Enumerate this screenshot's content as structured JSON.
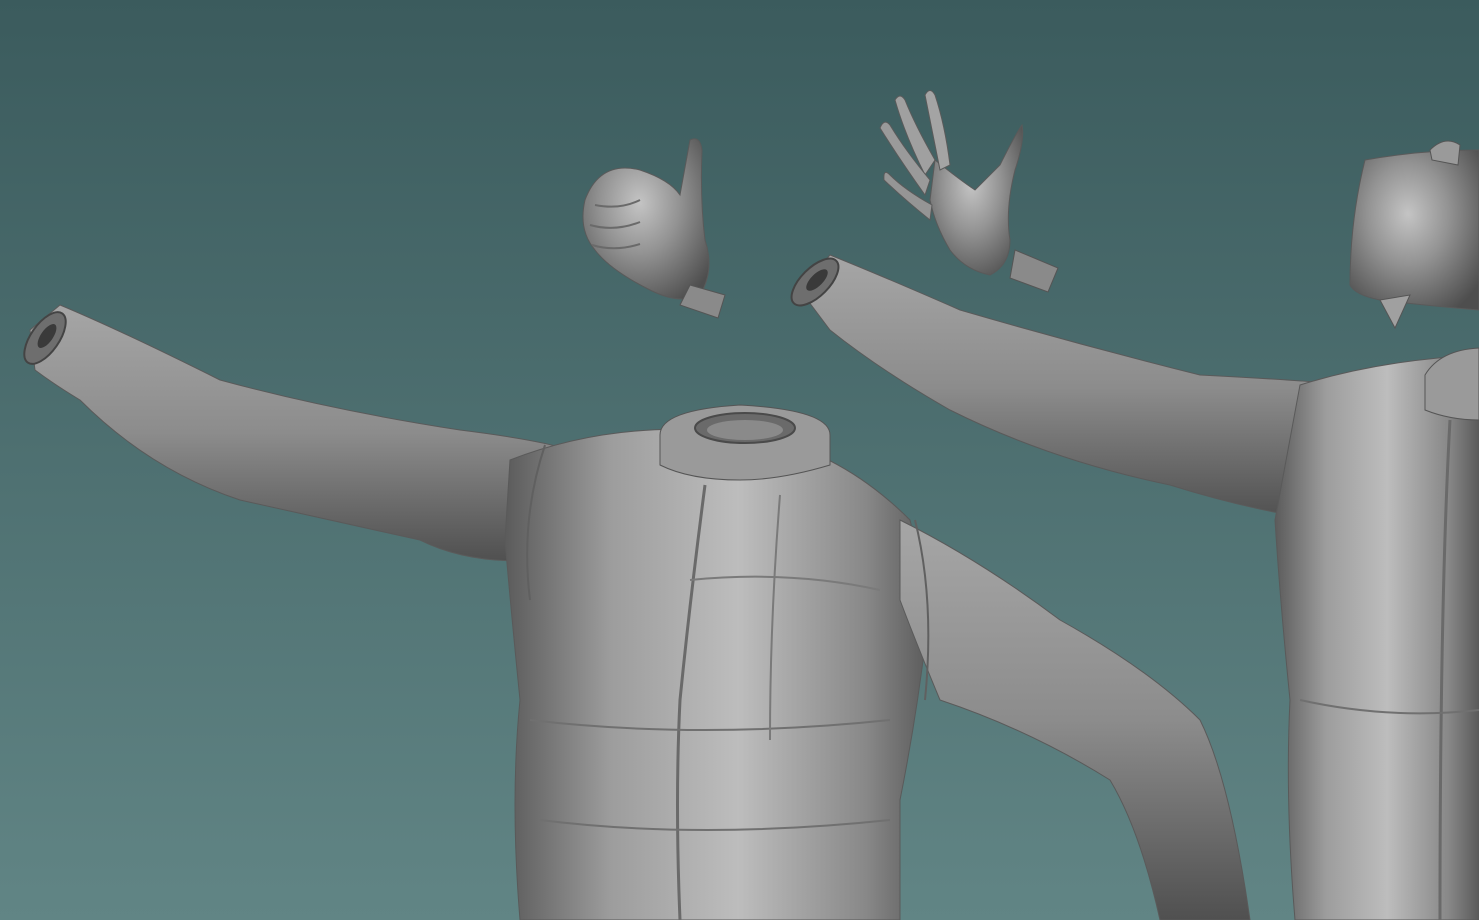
{
  "viewport": {
    "background_top": "#3d5d5f",
    "background_bottom": "#5f8484",
    "mesh_color": "#8a8a8a",
    "mesh_highlight": "#b5b5b5",
    "mesh_shadow": "#555555"
  },
  "scene": {
    "objects": [
      "jacket-mesh-left",
      "thumbs-up-hand-mesh",
      "open-hand-mesh",
      "jacket-mesh-right",
      "helmet-mesh"
    ]
  }
}
